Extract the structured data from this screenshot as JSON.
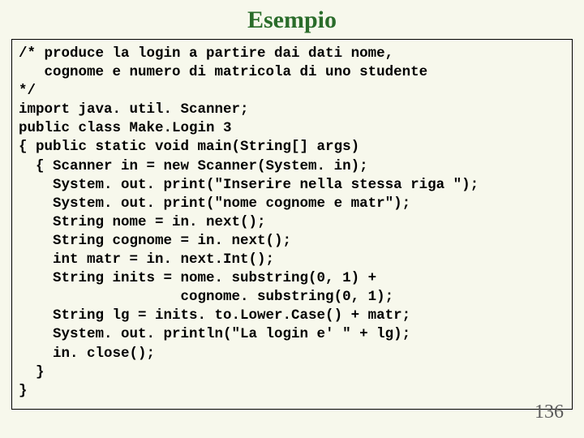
{
  "title": "Esempio",
  "page_number": "136",
  "code_lines": [
    "/* produce la login a partire dai dati nome,",
    "   cognome e numero di matricola di uno studente",
    "*/",
    "import java. util. Scanner;",
    "public class Make.Login 3",
    "{ public static void main(String[] args)",
    "  { Scanner in = new Scanner(System. in);",
    "    System. out. print(\"Inserire nella stessa riga \");",
    "    System. out. print(\"nome cognome e matr\");",
    "    String nome = in. next();",
    "    String cognome = in. next();",
    "    int matr = in. next.Int();",
    "    String inits = nome. substring(0, 1) +",
    "                   cognome. substring(0, 1);",
    "    String lg = inits. to.Lower.Case() + matr;",
    "    System. out. println(\"La login e' \" + lg);",
    "    in. close();",
    "  }",
    "}"
  ]
}
